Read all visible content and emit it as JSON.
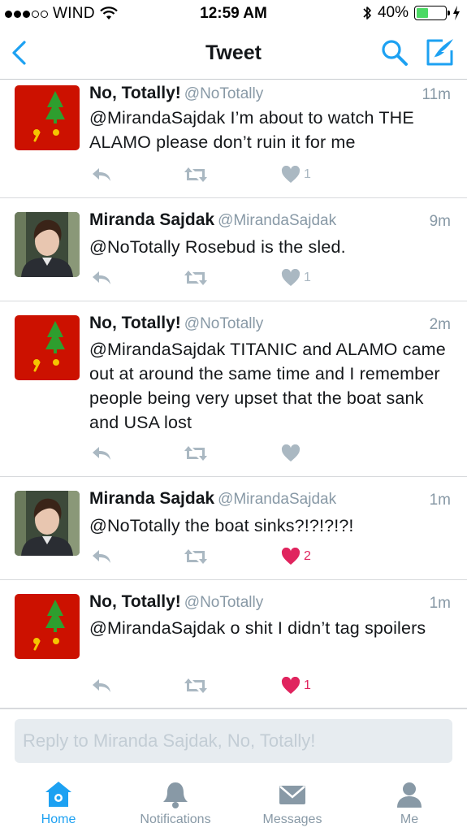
{
  "status_bar": {
    "carrier": "WIND",
    "time": "12:59 AM",
    "battery_percent": "40%",
    "battery_level": 0.4
  },
  "nav": {
    "title": "Tweet"
  },
  "tweets": [
    {
      "name": "No, Totally!",
      "handle": "@NoTotally",
      "time": "11m",
      "text": "@MirandaSajdak I’m about to watch THE ALAMO please don’t ruin it for me",
      "likes": "1",
      "liked": false
    },
    {
      "name": "Miranda Sajdak",
      "handle": "@MirandaSajdak",
      "time": "9m",
      "text": "@NoTotally Rosebud is the sled.",
      "likes": "1",
      "liked": false
    },
    {
      "name": "No, Totally!",
      "handle": "@NoTotally",
      "time": "2m",
      "text": "@MirandaSajdak TITANIC and ALAMO came out at around the same time and I remember people being very upset that the boat sank and USA lost",
      "likes": "",
      "liked": false
    },
    {
      "name": "Miranda Sajdak",
      "handle": "@MirandaSajdak",
      "time": "1m",
      "text": "@NoTotally the boat sinks?!?!?!?!",
      "likes": "2",
      "liked": true
    },
    {
      "name": "No, Totally!",
      "handle": "@NoTotally",
      "time": "1m",
      "text": "@MirandaSajdak o shit I didn’t tag spoilers",
      "likes": "1",
      "liked": true
    }
  ],
  "reply": {
    "placeholder": "Reply to Miranda Sajdak, No, Totally!"
  },
  "tabs": [
    {
      "label": "Home",
      "icon": "home-icon",
      "active": true
    },
    {
      "label": "Notifications",
      "icon": "bell-icon",
      "active": false
    },
    {
      "label": "Messages",
      "icon": "envelope-icon",
      "active": false
    },
    {
      "label": "Me",
      "icon": "person-icon",
      "active": false
    }
  ],
  "colors": {
    "accent": "#1da1f2",
    "like": "#e0245e",
    "muted": "#8899a6",
    "avatar_red": "#cc1100",
    "tree_green": "#2e9e2e",
    "avatar_yellow": "#f5c400"
  }
}
